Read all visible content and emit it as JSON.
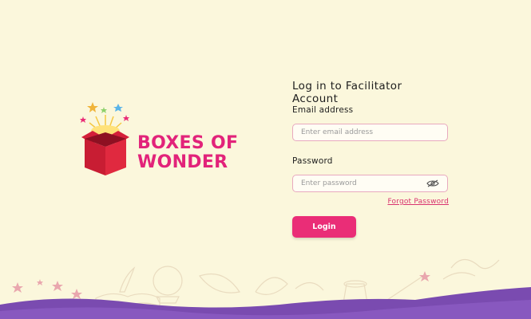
{
  "brand": {
    "line1": "BOXES OF",
    "line2": "WONDER",
    "color": "#e2237a"
  },
  "login": {
    "title": "Log in to Facilitator Account",
    "email_label": "Email address",
    "email_placeholder": "Enter email address",
    "email_value": "",
    "password_label": "Password",
    "password_placeholder": "Enter password",
    "password_value": "",
    "forgot_link": "Forgot Password",
    "login_button": "Login",
    "accent_color": "#ea2d77"
  },
  "icons": {
    "password_toggle": "eye-icon"
  },
  "footer": {
    "wave_color": "#7a4bb0",
    "decor": [
      "star-icons",
      "quill-icon",
      "open-book-icon",
      "crystal-ball-icon",
      "magic-hat-icon",
      "magic-wand-icon",
      "leaf-icon"
    ]
  }
}
